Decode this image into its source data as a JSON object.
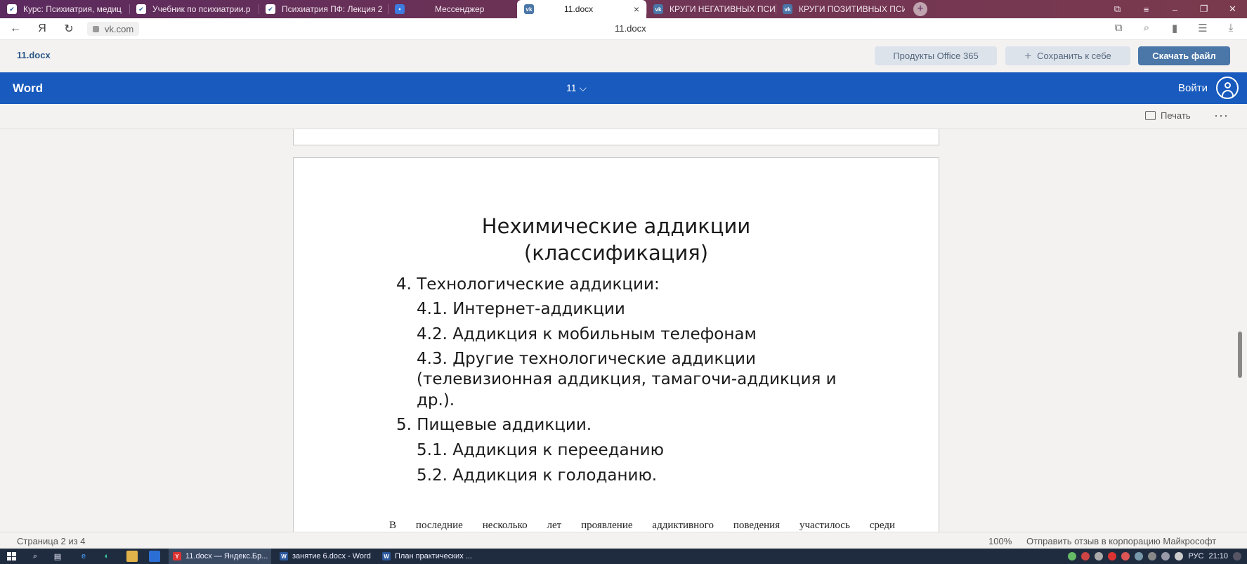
{
  "browser": {
    "tabs": [
      {
        "label": "Курс: Психиатрия, медиц",
        "icon": "moodle-icon"
      },
      {
        "label": "Учебник по психиатрии.р",
        "icon": "moodle-icon"
      },
      {
        "label": "Психиатрия ПФ: Лекция 2",
        "icon": "moodle-icon"
      },
      {
        "label": "Мессенджер",
        "icon": "messenger-icon"
      },
      {
        "label": "11.docx",
        "icon": "vk-icon",
        "active": true,
        "close": "×"
      },
      {
        "label": "КРУГИ НЕГАТИВНЫХ ПСИ",
        "icon": "vk-icon"
      },
      {
        "label": "КРУГИ ПОЗИТИВНЫХ ПСИ",
        "icon": "vk-icon"
      }
    ],
    "new_tab": "+",
    "window_controls": [
      "⧉",
      "≡",
      "–",
      "❐",
      "✕"
    ],
    "address": {
      "back": "←",
      "yandex": "Я",
      "reload": "↻",
      "url": "vk.com",
      "page_title": "11.docx"
    }
  },
  "doc_header": {
    "file_name": "11.docx",
    "office_button": "Продукты Office 365",
    "save_button": "Сохранить к себе",
    "save_plus": "+",
    "download_button": "Скачать файл"
  },
  "word_bar": {
    "app_name": "Word",
    "doc_title": "11 ⌵",
    "login": "Войти"
  },
  "toolbar": {
    "print": "Печать",
    "more": "···"
  },
  "slide": {
    "title_line1": "Нехимические аддикции",
    "title_line2": "(классификация)",
    "items": [
      "4. Технологические аддикции:",
      "4.1. Интернет-аддикции",
      "4.2. Аддикция к мобильным телефонам",
      "4.3. Другие технологические аддикции",
      "(телевизионная аддикция, тамагочи-аддикция и",
      "др.).",
      "5. Пищевые аддикции.",
      "5.1. Аддикция к перееданию",
      "5.2. Аддикция к голоданию."
    ]
  },
  "body_text": "В последние несколько лет проявление аддиктивного поведения участилось среди",
  "status_bar": {
    "page": "Страница 2 из 4",
    "zoom": "100%",
    "feedback": "Отправить отзыв в корпорацию Майкрософт"
  },
  "taskbar": {
    "apps": [
      {
        "label": "11.docx — Яндекс.Бр...",
        "active": true
      },
      {
        "label": "занятие 6.docx - Word",
        "active": false
      },
      {
        "label": "План практических ...",
        "active": false
      }
    ],
    "lang": "РУС",
    "time": "21:10"
  },
  "colors": {
    "word_blue": "#185abd",
    "vk_blue": "#4a76a8",
    "tabstrip": "#6e3355"
  }
}
